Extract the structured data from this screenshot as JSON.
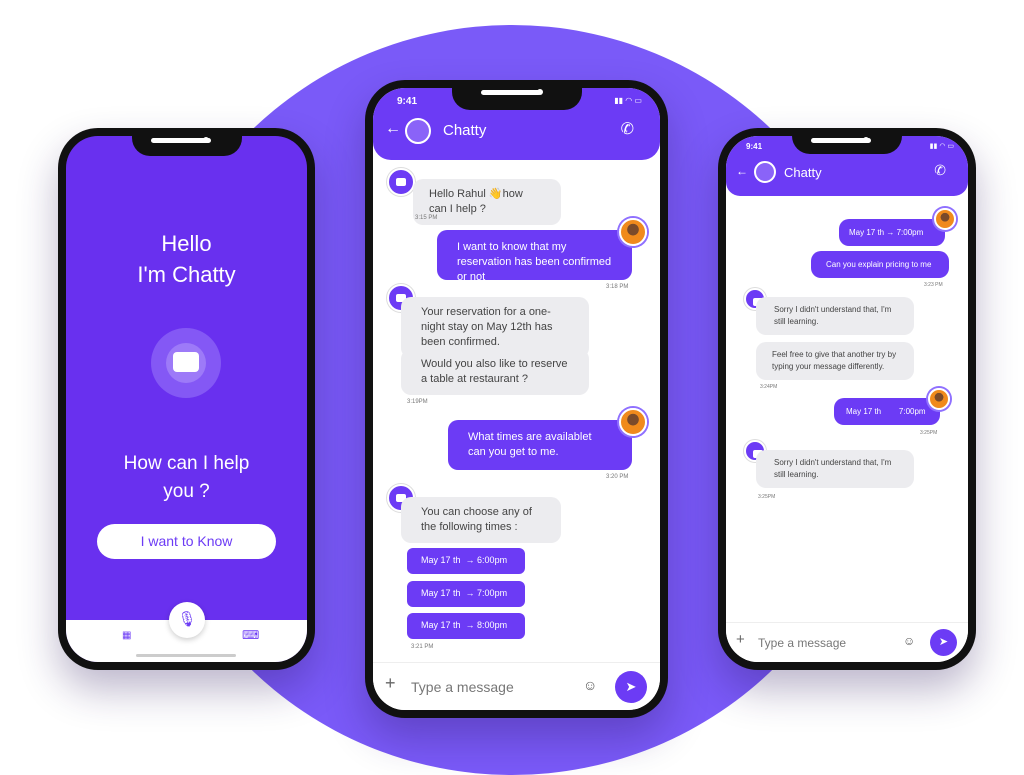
{
  "colors": {
    "accent": "#6c3bf5",
    "background_circle": "#7a5af8",
    "bubble_bot": "#ececef"
  },
  "left": {
    "greeting": "Hello",
    "name": "I'm Chatty",
    "prompt": "How can I help you ?",
    "cta": "I want to Know",
    "icons": [
      "grid-icon",
      "mic-icon",
      "keyboard-icon"
    ]
  },
  "middle": {
    "status_time": "9:41",
    "title": "Chatty",
    "messages": [
      {
        "from": "bot",
        "text": "Hello Rahul 👋how can I help ?",
        "time": "3:15 PM"
      },
      {
        "from": "user",
        "text": "I want to know that my reservation has been confirmed or not",
        "time": "3:18 PM"
      },
      {
        "from": "bot",
        "text": "Your reservation for a one-night stay on May 12th has been confirmed."
      },
      {
        "from": "bot",
        "text": "Would you also like to reserve a table at restaurant ?",
        "time": "3:19PM"
      },
      {
        "from": "user",
        "text": "What times are availablet can you get to me.",
        "time": "3:20 PM"
      },
      {
        "from": "bot",
        "text": "You can choose any of the following times :"
      }
    ],
    "options": [
      {
        "date": "May 17 th",
        "time": "6:00pm"
      },
      {
        "date": "May 17 th",
        "time": "7:00pm"
      },
      {
        "date": "May 17 th",
        "time": "8:00pm"
      }
    ],
    "options_time": "3:21 PM",
    "input_placeholder": "Type a message"
  },
  "right": {
    "status_time": "9:41",
    "title": "Chatty",
    "messages": [
      {
        "from": "user",
        "text": "May 17 th → 7:00pm"
      },
      {
        "from": "user",
        "text": "Can you explain pricing to me",
        "time": "3:23 PM"
      },
      {
        "from": "bot",
        "text": "Sorry I didn't understand that, I'm still learning."
      },
      {
        "from": "bot",
        "text": "Feel  free to give that another try by typing your message differently.",
        "time": "3:24PM"
      },
      {
        "from": "user",
        "text": "May 17 th        7:00pm",
        "time": "3:25PM"
      },
      {
        "from": "bot",
        "text": "Sorry I didn't understand that, I'm still learning.",
        "time": "3:25PM"
      }
    ],
    "input_placeholder": "Type a message"
  }
}
